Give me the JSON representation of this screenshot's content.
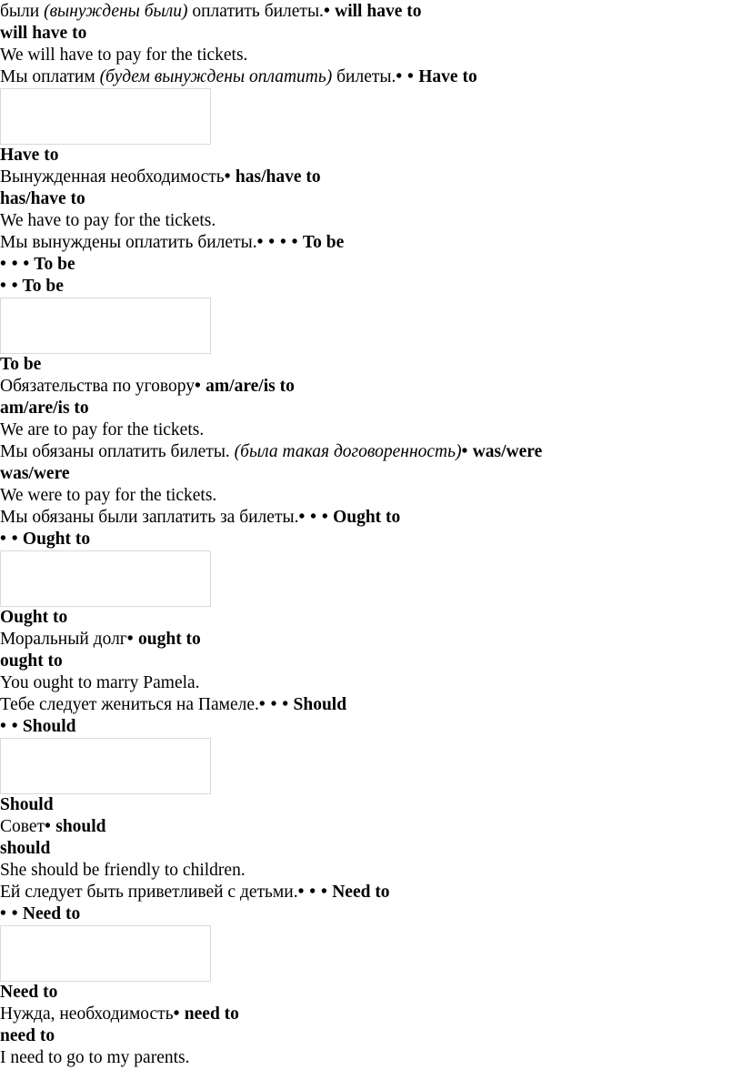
{
  "document": {
    "type": "grammar-reference-handout",
    "language_pair": "Russian-English",
    "topic": "Modal verbs of obligation and necessity",
    "page_background": "#ffffff",
    "text_color": "#000000",
    "placeholder_border_color": "#d9d9d9",
    "bullet_glyph": "•"
  },
  "lines": [
    {
      "id": "line-1",
      "segments": [
        {
          "text": "были ",
          "style": "normal"
        },
        {
          "text": "(вынуждены были)",
          "style": "italic"
        },
        {
          "text": " оплатить билеты.",
          "style": "normal"
        },
        {
          "text": "•",
          "style": "bullets"
        },
        {
          "text": " will have to",
          "style": "bold"
        }
      ]
    },
    {
      "id": "line-2",
      "segments": [
        {
          "text": "will have to",
          "style": "bold"
        }
      ]
    },
    {
      "id": "line-3",
      "segments": [
        {
          "text": "We will have to pay for the tickets.",
          "style": "normal"
        }
      ]
    },
    {
      "id": "line-4",
      "segments": [
        {
          "text": "Мы оплатим ",
          "style": "normal"
        },
        {
          "text": "(будем вынуждены оплатить)",
          "style": "italic"
        },
        {
          "text": " билеты.",
          "style": "normal"
        },
        {
          "text": "• •",
          "style": "bullets"
        },
        {
          "text": " Have to",
          "style": "bold"
        }
      ]
    },
    {
      "id": "placeholder-1",
      "segments": [],
      "is_placeholder": true
    },
    {
      "id": "line-5",
      "segments": [
        {
          "text": "Have to",
          "style": "bold"
        }
      ]
    },
    {
      "id": "line-6",
      "segments": [
        {
          "text": "Вынужденная необходимость",
          "style": "normal"
        },
        {
          "text": "•",
          "style": "bullets"
        },
        {
          "text": " has/have to",
          "style": "bold"
        }
      ]
    },
    {
      "id": "line-7",
      "segments": [
        {
          "text": "has/have to",
          "style": "bold"
        }
      ]
    },
    {
      "id": "line-8",
      "segments": [
        {
          "text": "We have to pay for the tickets.",
          "style": "normal"
        }
      ]
    },
    {
      "id": "line-9",
      "segments": [
        {
          "text": "Мы вынуждены оплатить билеты.",
          "style": "normal"
        },
        {
          "text": "• • • •",
          "style": "bullets"
        },
        {
          "text": " To be",
          "style": "bold"
        }
      ]
    },
    {
      "id": "line-10",
      "segments": [
        {
          "text": "• • •",
          "style": "bullets"
        },
        {
          "text": " To be",
          "style": "bold"
        }
      ]
    },
    {
      "id": "line-11",
      "segments": [
        {
          "text": "• •",
          "style": "bullets"
        },
        {
          "text": " To be",
          "style": "bold"
        }
      ]
    },
    {
      "id": "placeholder-2",
      "segments": [],
      "is_placeholder": true
    },
    {
      "id": "line-12",
      "segments": [
        {
          "text": "To be",
          "style": "bold"
        }
      ]
    },
    {
      "id": "line-13",
      "segments": [
        {
          "text": "Обязательства по уговору",
          "style": "normal"
        },
        {
          "text": "•",
          "style": "bullets"
        },
        {
          "text": " am/are/is to",
          "style": "bold"
        }
      ]
    },
    {
      "id": "line-14",
      "segments": [
        {
          "text": "am/are/is to",
          "style": "bold"
        }
      ]
    },
    {
      "id": "line-15",
      "segments": [
        {
          "text": "We are to pay for the tickets.",
          "style": "normal"
        }
      ]
    },
    {
      "id": "line-16",
      "segments": [
        {
          "text": "Мы обязаны оплатить билеты. ",
          "style": "normal"
        },
        {
          "text": "(была такая договоренность)",
          "style": "italic"
        },
        {
          "text": "•",
          "style": "bullets"
        },
        {
          "text": " was/were",
          "style": "bold"
        }
      ]
    },
    {
      "id": "line-17",
      "segments": [
        {
          "text": "was/were",
          "style": "bold"
        }
      ]
    },
    {
      "id": "line-18",
      "segments": [
        {
          "text": "We were to pay for the tickets.",
          "style": "normal"
        }
      ]
    },
    {
      "id": "line-19",
      "segments": [
        {
          "text": "Мы обязаны были заплатить за билеты.",
          "style": "normal"
        },
        {
          "text": "• • •",
          "style": "bullets"
        },
        {
          "text": " Ought to",
          "style": "bold"
        }
      ]
    },
    {
      "id": "line-20",
      "segments": [
        {
          "text": "• •",
          "style": "bullets"
        },
        {
          "text": " Ought to",
          "style": "bold"
        }
      ]
    },
    {
      "id": "placeholder-3",
      "segments": [],
      "is_placeholder": true
    },
    {
      "id": "line-21",
      "segments": [
        {
          "text": "Ought to",
          "style": "bold"
        }
      ]
    },
    {
      "id": "line-22",
      "segments": [
        {
          "text": "Моральный долг",
          "style": "normal"
        },
        {
          "text": "•",
          "style": "bullets"
        },
        {
          "text": " ought to",
          "style": "bold"
        }
      ]
    },
    {
      "id": "line-23",
      "segments": [
        {
          "text": "ought to",
          "style": "bold"
        }
      ]
    },
    {
      "id": "line-24",
      "segments": [
        {
          "text": "You ought to marry Pamela.",
          "style": "normal"
        }
      ]
    },
    {
      "id": "line-25",
      "segments": [
        {
          "text": "Тебе следует жениться на Памеле.",
          "style": "normal"
        },
        {
          "text": "• • •",
          "style": "bullets"
        },
        {
          "text": " Should",
          "style": "bold"
        }
      ]
    },
    {
      "id": "line-26",
      "segments": [
        {
          "text": "• •",
          "style": "bullets"
        },
        {
          "text": " Should",
          "style": "bold"
        }
      ]
    },
    {
      "id": "placeholder-4",
      "segments": [],
      "is_placeholder": true
    },
    {
      "id": "line-27",
      "segments": [
        {
          "text": "Should",
          "style": "bold"
        }
      ]
    },
    {
      "id": "line-28",
      "segments": [
        {
          "text": "Совет",
          "style": "normal"
        },
        {
          "text": "•",
          "style": "bullets"
        },
        {
          "text": " should",
          "style": "bold"
        }
      ]
    },
    {
      "id": "line-29",
      "segments": [
        {
          "text": "should",
          "style": "bold"
        }
      ]
    },
    {
      "id": "line-30",
      "segments": [
        {
          "text": "She should be friendly to children.",
          "style": "normal"
        }
      ]
    },
    {
      "id": "line-31",
      "segments": [
        {
          "text": "Ей следует быть приветливей с детьми.",
          "style": "normal"
        },
        {
          "text": "• • •",
          "style": "bullets"
        },
        {
          "text": " Need to",
          "style": "bold"
        }
      ]
    },
    {
      "id": "line-32",
      "segments": [
        {
          "text": "• •",
          "style": "bullets"
        },
        {
          "text": " Need to",
          "style": "bold"
        }
      ]
    },
    {
      "id": "placeholder-5",
      "segments": [],
      "is_placeholder": true
    },
    {
      "id": "line-33",
      "segments": [
        {
          "text": "Need to",
          "style": "bold"
        }
      ]
    },
    {
      "id": "line-34",
      "segments": [
        {
          "text": "Нужда, необходимость",
          "style": "normal"
        },
        {
          "text": "•",
          "style": "bullets"
        },
        {
          "text": " need to",
          "style": "bold"
        }
      ]
    },
    {
      "id": "line-35",
      "segments": [
        {
          "text": "need to",
          "style": "bold"
        }
      ]
    },
    {
      "id": "line-36",
      "segments": [
        {
          "text": "I need to go to my parents.",
          "style": "normal"
        }
      ]
    }
  ]
}
